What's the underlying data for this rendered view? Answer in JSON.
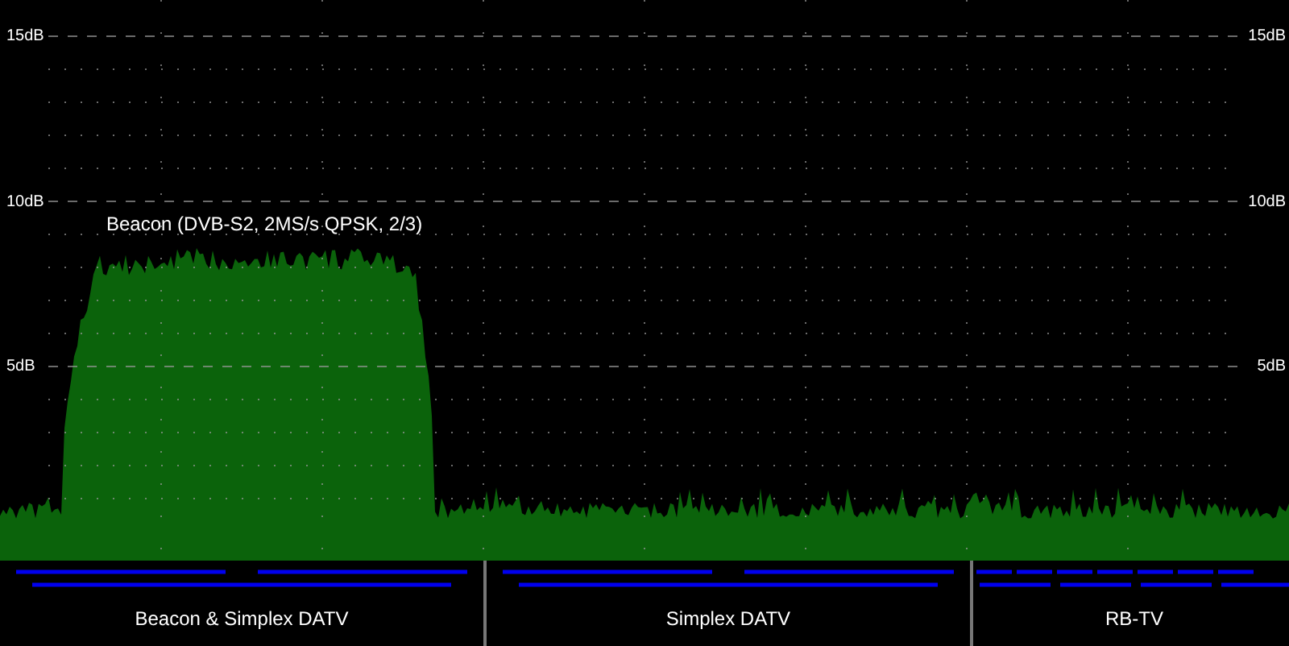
{
  "plot": {
    "left_labels": [
      "15dB",
      "10dB",
      "5dB"
    ],
    "right_labels": [
      "15dB",
      "10dB",
      "5dB"
    ],
    "annotation": "Beacon (DVB-S2, 2MS/s QPSK, 2/3)"
  },
  "bands": [
    {
      "label": "Beacon & Simplex DATV",
      "kind": "wide"
    },
    {
      "label": "Simplex DATV",
      "kind": "wide"
    },
    {
      "label": "RB-TV",
      "kind": "narrow"
    }
  ]
}
